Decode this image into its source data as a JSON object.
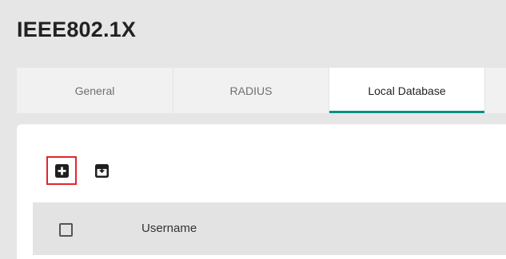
{
  "page": {
    "title": "IEEE802.1X"
  },
  "tabs": [
    {
      "label": "General",
      "active": false
    },
    {
      "label": "RADIUS",
      "active": false
    },
    {
      "label": "Local Database",
      "active": true
    }
  ],
  "toolbar": {
    "add": {
      "icon": "add-box-icon"
    },
    "export": {
      "icon": "download-box-icon"
    },
    "highlight_color": "#e0262d"
  },
  "table": {
    "columns": [
      "Username"
    ]
  },
  "colors": {
    "accent": "#0a8f8a",
    "title": "#222222",
    "background": "#e6e6e6"
  }
}
